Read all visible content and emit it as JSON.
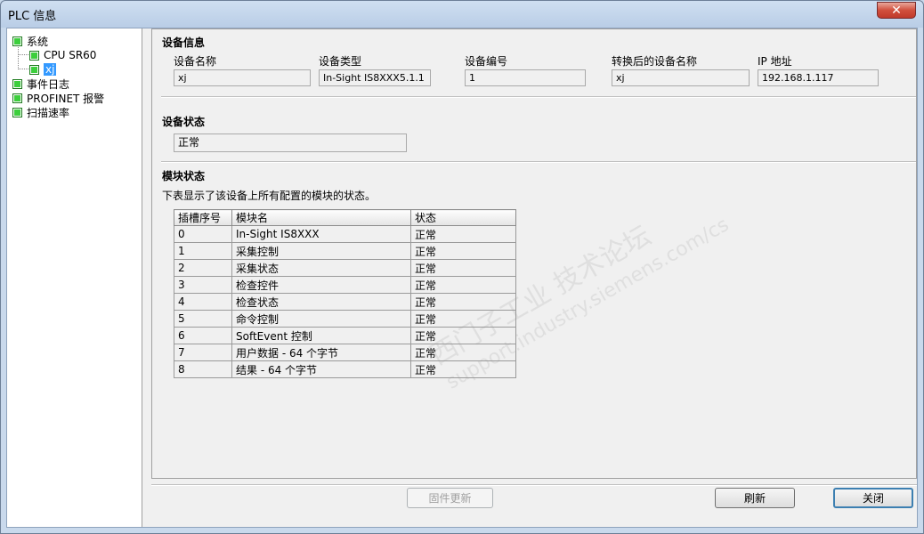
{
  "window": {
    "title": "PLC 信息",
    "close_glyph": "✕"
  },
  "tree": {
    "items": [
      {
        "label": "系统"
      },
      {
        "label": "CPU SR60"
      },
      {
        "label": "xj"
      },
      {
        "label": "事件日志"
      },
      {
        "label": "PROFINET 报警"
      },
      {
        "label": "扫描速率"
      }
    ]
  },
  "device_info": {
    "title": "设备信息",
    "fields": [
      {
        "label": "设备名称",
        "value": "xj"
      },
      {
        "label": "设备类型",
        "value": "In-Sight IS8XXX5.1.1"
      },
      {
        "label": "设备编号",
        "value": "1"
      },
      {
        "label": "转换后的设备名称",
        "value": "xj"
      },
      {
        "label": "IP 地址",
        "value": "192.168.1.117"
      }
    ]
  },
  "device_status": {
    "title": "设备状态",
    "value": "正常"
  },
  "module_status": {
    "title": "模块状态",
    "description": "下表显示了该设备上所有配置的模块的状态。",
    "columns": [
      "插槽序号",
      "模块名",
      "状态"
    ],
    "rows": [
      [
        "0",
        "In-Sight IS8XXX",
        "正常"
      ],
      [
        "1",
        "采集控制",
        "正常"
      ],
      [
        "2",
        "采集状态",
        "正常"
      ],
      [
        "3",
        "检查控件",
        "正常"
      ],
      [
        "4",
        "检查状态",
        "正常"
      ],
      [
        "5",
        "命令控制",
        "正常"
      ],
      [
        "6",
        "SoftEvent 控制",
        "正常"
      ],
      [
        "7",
        "用户数据 - 64 个字节",
        "正常"
      ],
      [
        "8",
        "结果 - 64 个字节",
        "正常"
      ]
    ]
  },
  "watermark": {
    "line1": "西门子工业 技术论坛",
    "line2": "support.industry.siemens.com/cs"
  },
  "buttons": {
    "firmware": "固件更新",
    "refresh": "刷新",
    "close": "关闭"
  },
  "colors": {
    "status_node": "#3ccf3c",
    "selection": "#3399ff",
    "close_button": "#c0392b"
  }
}
